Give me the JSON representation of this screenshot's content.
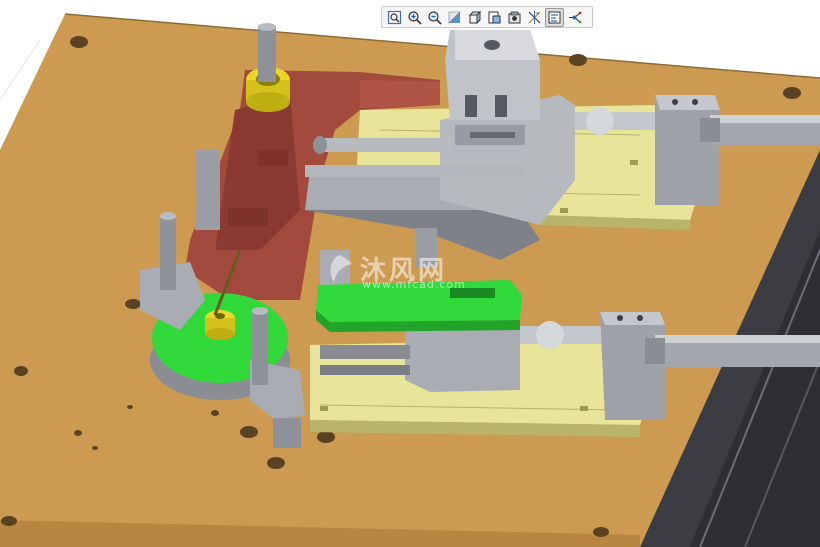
{
  "toolbar": {
    "buttons": [
      {
        "id": "refit",
        "icon": "zoom-fit-icon",
        "active": false
      },
      {
        "id": "zoom-in",
        "icon": "zoom-in-icon",
        "active": false
      },
      {
        "id": "zoom-out",
        "icon": "zoom-out-icon",
        "active": false
      },
      {
        "id": "repaint",
        "icon": "repaint-icon",
        "active": false
      },
      {
        "id": "saved-views",
        "icon": "saved-views-icon",
        "active": false
      },
      {
        "id": "display-style",
        "icon": "display-style-icon",
        "active": false
      },
      {
        "id": "view-manager",
        "icon": "view-manager-icon",
        "active": false
      },
      {
        "id": "datum-display",
        "icon": "datum-display-icon",
        "active": false
      },
      {
        "id": "annotation-display",
        "icon": "annotation-display-icon",
        "active": true
      },
      {
        "id": "spin-center",
        "icon": "spin-center-icon",
        "active": false
      }
    ]
  },
  "watermark": {
    "text": "沐风网",
    "url": "www.mfcad.com"
  },
  "colors": {
    "base_plate": "#cc9a50",
    "rail_plate": "#e8e59a",
    "red_bracket": "#a34a3e",
    "green_plate": "#32d93a",
    "yellow_part": "#e9d827",
    "steel": "#a9adb3",
    "dark_frame": "#3b3d42"
  }
}
